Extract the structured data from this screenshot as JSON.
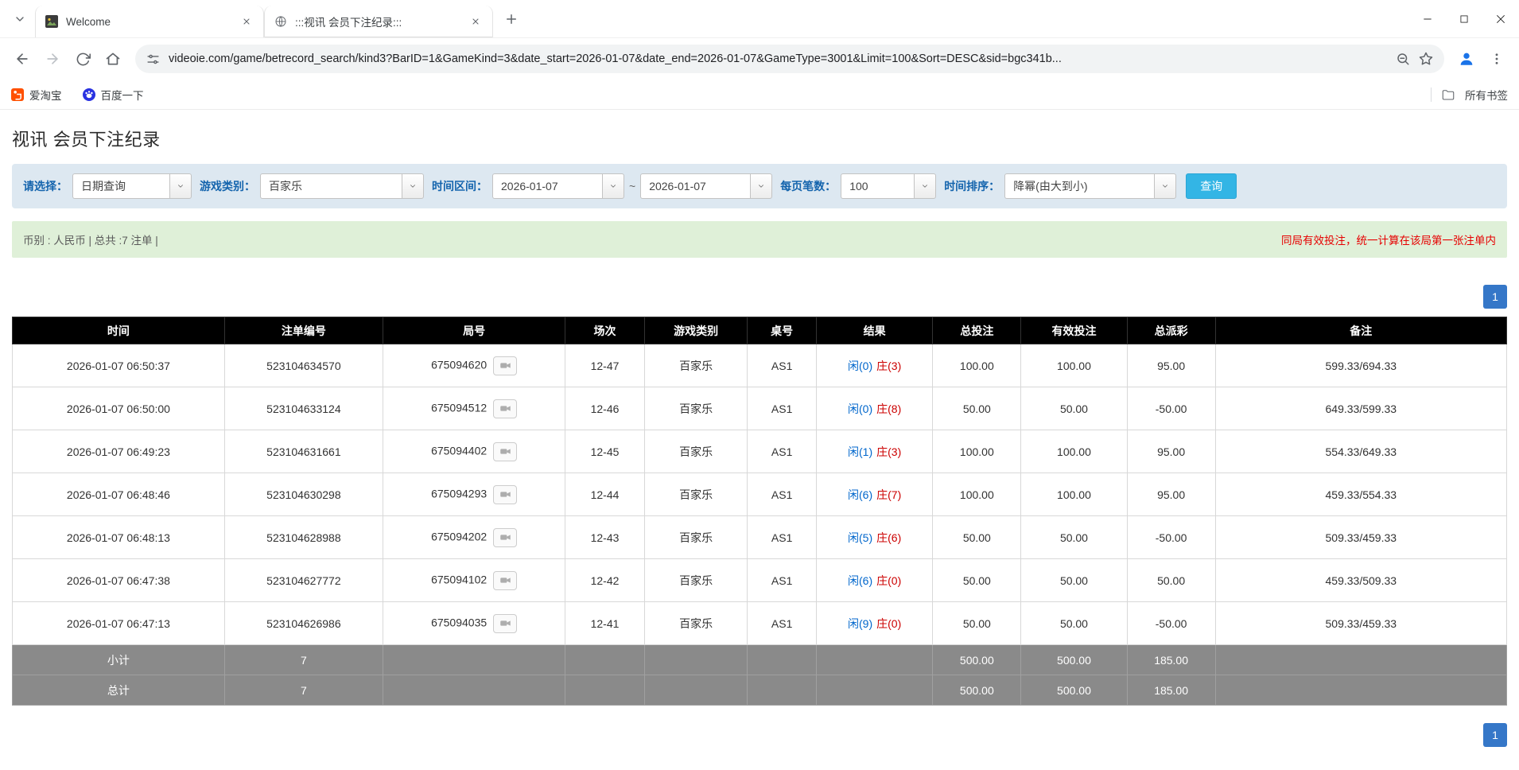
{
  "browser": {
    "tabs": [
      {
        "title": "Welcome"
      },
      {
        "title": ":::视讯 会员下注纪录:::"
      }
    ],
    "url": "videoie.com/game/betrecord_search/kind3?BarID=1&GameKind=3&date_start=2026-01-07&date_end=2026-01-07&GameType=3001&Limit=100&Sort=DESC&sid=bgc341b...",
    "bookmarks": [
      {
        "label": "爱淘宝"
      },
      {
        "label": "百度一下"
      }
    ],
    "all_bookmarks_label": "所有书签"
  },
  "page": {
    "title": "视讯 会员下注纪录",
    "filters": {
      "select_label": "请选择：",
      "select_value": "日期查询",
      "game_type_label": "游戏类别：",
      "game_type_value": "百家乐",
      "date_range_label": "时间区间：",
      "date_start": "2026-01-07",
      "range_separator": "~",
      "date_end": "2026-01-07",
      "page_size_label": "每页笔数：",
      "page_size_value": "100",
      "sort_label": "时间排序：",
      "sort_value": "降幂(由大到小)",
      "search_button": "查询"
    },
    "summary": {
      "left": "币别 : 人民币 | 总共 :7 注单 |",
      "right": "同局有效投注，统一计算在该局第一张注单内"
    },
    "pagination": "1",
    "table": {
      "headers": [
        "时间",
        "注单编号",
        "局号",
        "场次",
        "游戏类别",
        "桌号",
        "结果",
        "总投注",
        "有效投注",
        "总派彩",
        "备注"
      ],
      "rows": [
        {
          "time": "2026-01-07 06:50:37",
          "bet_id": "523104634570",
          "round": "675094620",
          "session": "12-47",
          "game": "百家乐",
          "table_no": "AS1",
          "result_player": "闲(0)",
          "result_banker": "庄(3)",
          "total_bet": "100.00",
          "valid_bet": "100.00",
          "payout": "95.00",
          "note": "599.33/694.33"
        },
        {
          "time": "2026-01-07 06:50:00",
          "bet_id": "523104633124",
          "round": "675094512",
          "session": "12-46",
          "game": "百家乐",
          "table_no": "AS1",
          "result_player": "闲(0)",
          "result_banker": "庄(8)",
          "total_bet": "50.00",
          "valid_bet": "50.00",
          "payout": "-50.00",
          "note": "649.33/599.33"
        },
        {
          "time": "2026-01-07 06:49:23",
          "bet_id": "523104631661",
          "round": "675094402",
          "session": "12-45",
          "game": "百家乐",
          "table_no": "AS1",
          "result_player": "闲(1)",
          "result_banker": "庄(3)",
          "total_bet": "100.00",
          "valid_bet": "100.00",
          "payout": "95.00",
          "note": "554.33/649.33"
        },
        {
          "time": "2026-01-07 06:48:46",
          "bet_id": "523104630298",
          "round": "675094293",
          "session": "12-44",
          "game": "百家乐",
          "table_no": "AS1",
          "result_player": "闲(6)",
          "result_banker": "庄(7)",
          "total_bet": "100.00",
          "valid_bet": "100.00",
          "payout": "95.00",
          "note": "459.33/554.33"
        },
        {
          "time": "2026-01-07 06:48:13",
          "bet_id": "523104628988",
          "round": "675094202",
          "session": "12-43",
          "game": "百家乐",
          "table_no": "AS1",
          "result_player": "闲(5)",
          "result_banker": "庄(6)",
          "total_bet": "50.00",
          "valid_bet": "50.00",
          "payout": "-50.00",
          "note": "509.33/459.33"
        },
        {
          "time": "2026-01-07 06:47:38",
          "bet_id": "523104627772",
          "round": "675094102",
          "session": "12-42",
          "game": "百家乐",
          "table_no": "AS1",
          "result_player": "闲(6)",
          "result_banker": "庄(0)",
          "total_bet": "50.00",
          "valid_bet": "50.00",
          "payout": "50.00",
          "note": "459.33/509.33"
        },
        {
          "time": "2026-01-07 06:47:13",
          "bet_id": "523104626986",
          "round": "675094035",
          "session": "12-41",
          "game": "百家乐",
          "table_no": "AS1",
          "result_player": "闲(9)",
          "result_banker": "庄(0)",
          "total_bet": "50.00",
          "valid_bet": "50.00",
          "payout": "-50.00",
          "note": "509.33/459.33"
        }
      ],
      "subtotal": {
        "label": "小计",
        "count": "7",
        "total_bet": "500.00",
        "valid_bet": "500.00",
        "payout": "185.00"
      },
      "grand_total": {
        "label": "总计",
        "count": "7",
        "total_bet": "500.00",
        "valid_bet": "500.00",
        "payout": "185.00"
      }
    }
  },
  "colors": {
    "accent_blue": "#0066cc",
    "banker_red": "#cc0000",
    "negative_red": "#ee0000",
    "notice_red": "#e60000",
    "query_button_blue": "#33b5e5",
    "pagination_blue": "#3577c8",
    "filter_bg": "#dde8f1",
    "filter_label_blue": "#1464ad",
    "summary_bg": "#dff0d8",
    "table_header_bg": "#000000",
    "table_footer_bg": "#8a8a8a"
  }
}
